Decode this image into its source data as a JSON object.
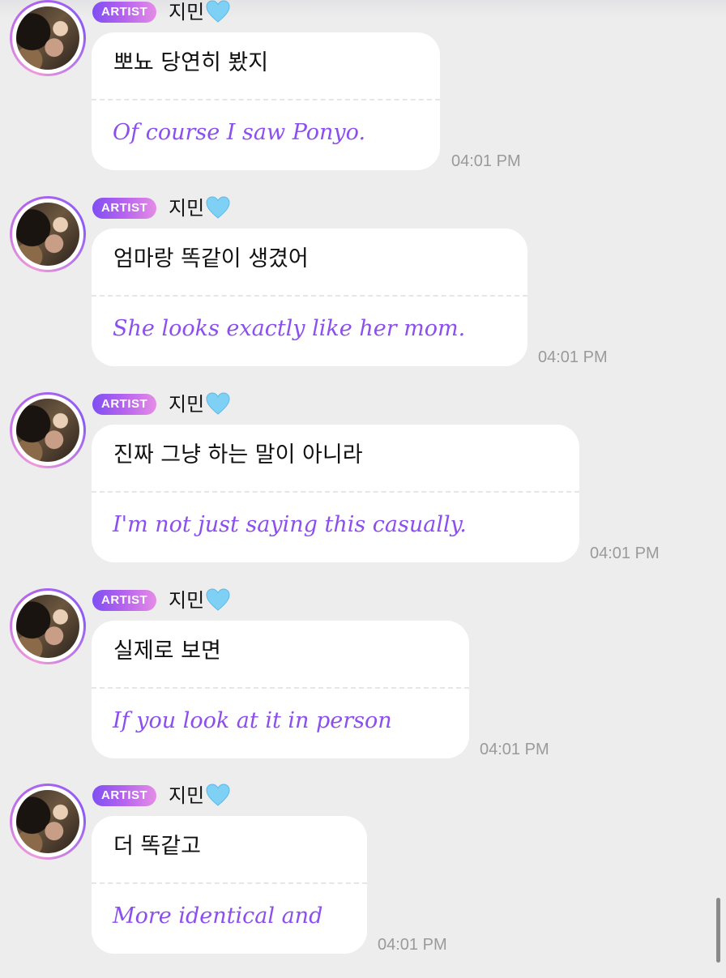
{
  "chat": {
    "messages": [
      {
        "badge": "ARTIST",
        "sender": "지민",
        "sender_icon": "light-blue-heart-icon",
        "original": "뽀뇨 당연히 봤지",
        "translation": "Of course I saw Ponyo.",
        "time": "04:01 PM"
      },
      {
        "badge": "ARTIST",
        "sender": "지민",
        "sender_icon": "light-blue-heart-icon",
        "original": "엄마랑 똑같이 생겼어",
        "translation": "She looks exactly like her mom.",
        "time": "04:01 PM"
      },
      {
        "badge": "ARTIST",
        "sender": "지민",
        "sender_icon": "light-blue-heart-icon",
        "original": "진짜 그냥 하는 말이 아니라",
        "translation": "I'm not just saying this casually.",
        "time": "04:01 PM"
      },
      {
        "badge": "ARTIST",
        "sender": "지민",
        "sender_icon": "light-blue-heart-icon",
        "original": "실제로 보면",
        "translation": "If you look at it in person",
        "time": "04:01 PM"
      },
      {
        "badge": "ARTIST",
        "sender": "지민",
        "sender_icon": "light-blue-heart-icon",
        "original": "더 똑같고",
        "translation": "More identical and",
        "time": "04:01 PM"
      }
    ]
  },
  "colors": {
    "background": "#ededee",
    "bubble": "#ffffff",
    "translation_text": "#8b4ff0",
    "timestamp": "#9a9a9a",
    "badge_gradient_start": "#7f4ff2",
    "badge_gradient_end": "#e58ce6",
    "heart": "#7fd0f5"
  }
}
